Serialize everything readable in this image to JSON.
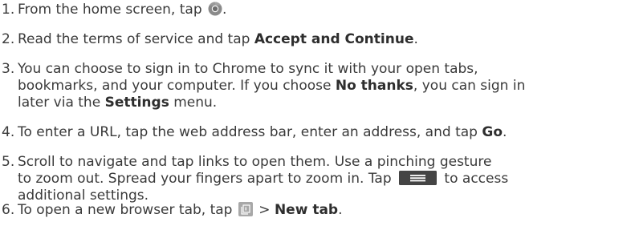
{
  "steps": [
    {
      "number": "1.",
      "line1": {
        "before": "From the home screen, tap ",
        "after": "."
      }
    },
    {
      "number": "2.",
      "line1": {
        "before": "Read the terms of service and tap ",
        "bold": "Accept and Continue",
        "after": "."
      }
    },
    {
      "number": "3.",
      "line1": "You can choose to sign in to Chrome to sync it with your open tabs,",
      "line2": {
        "before": "bookmarks, and your computer. If you choose ",
        "bold": "No thanks",
        "after": ", you can sign in"
      },
      "line3": {
        "before": "later via the ",
        "bold": "Settings",
        "after": " menu."
      }
    },
    {
      "number": "4.",
      "line1": {
        "before": "To enter a URL, tap the web address bar, enter an address, and tap ",
        "bold": "Go",
        "after": "."
      }
    },
    {
      "number": "5.",
      "line1": "Scroll to navigate and tap links to open them. Use a pinching gesture",
      "line2": {
        "before": "to zoom out. Spread your fingers apart to zoom in. Tap ",
        "after": " to access"
      },
      "line3": "additional settings."
    },
    {
      "number": "6.",
      "line1": {
        "before": "To open a new browser tab, tap ",
        "middle": " > ",
        "bold": "New tab",
        "after": "."
      }
    }
  ],
  "icons": {
    "chrome": "chrome-icon",
    "menu": "menu-icon",
    "tabs": "tabs-icon"
  },
  "colors": {
    "text": "#3a3a3a",
    "icon_gray": "#7a7a7a",
    "menu_button": "#444444",
    "tabs_tile": "#a8a8a8"
  }
}
